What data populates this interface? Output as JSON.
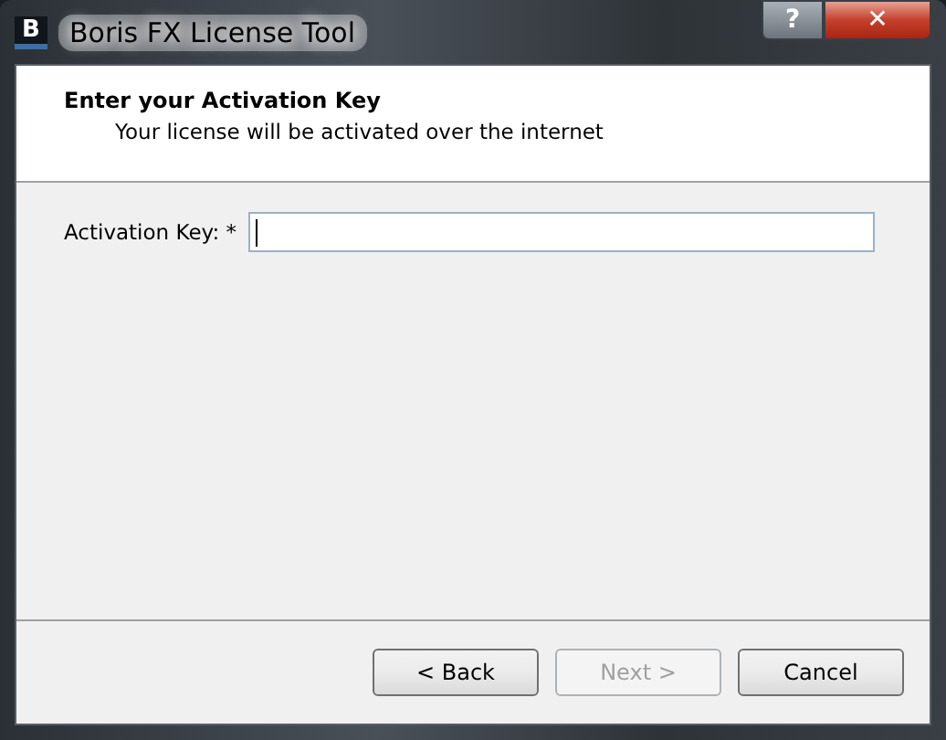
{
  "window": {
    "title": "Boris FX License Tool",
    "logo": "B",
    "help_button": "?",
    "close_button": "✕"
  },
  "header": {
    "title": "Enter your Activation Key",
    "subtitle": "Your license will be activated over the internet"
  },
  "form": {
    "label": "Activation Key: *",
    "focused": true
  },
  "buttons": [
    {
      "label": "< Back",
      "disabled": false
    },
    {
      "label": "Next >",
      "disabled": true
    },
    {
      "label": "Cancel",
      "disabled": false
    }
  ]
}
